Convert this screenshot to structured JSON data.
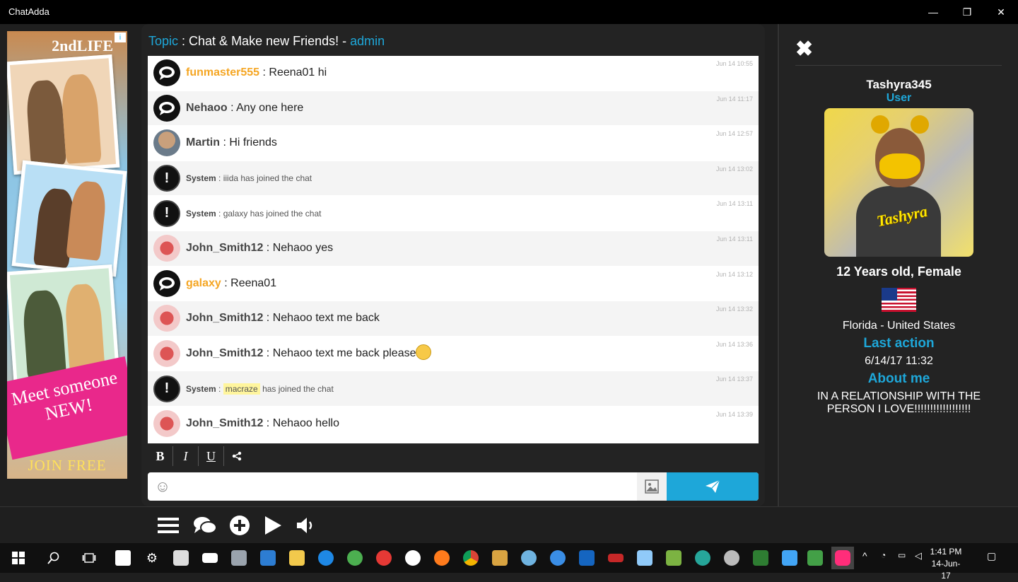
{
  "window": {
    "title": "ChatAdda",
    "minimize": "—",
    "maximize": "❐",
    "close": "✕"
  },
  "ad": {
    "brand": "2ndLIFE",
    "info": "i",
    "tagline": "Meet someone NEW!",
    "cta": "JOIN FREE"
  },
  "topic": {
    "label": "Topic",
    "text": " : Chat & Make new Friends! - ",
    "author": "admin"
  },
  "messages": [
    {
      "user": "funmaster555",
      "text": " : Reena01 hi",
      "time": "Jun 14 10:55",
      "avatar": "bubble",
      "name_color": "orange",
      "kind": "chat"
    },
    {
      "user": "Nehaoo",
      "text": " : Any one here",
      "time": "Jun 14 11:17",
      "avatar": "bubble",
      "name_color": "default",
      "kind": "chat"
    },
    {
      "user": "Martin",
      "text": " : Hi friends",
      "time": "Jun 14 12:57",
      "avatar": "photo",
      "name_color": "default",
      "kind": "chat"
    },
    {
      "user": "System",
      "text": " : iiida has joined the chat",
      "time": "Jun 14 13:02",
      "avatar": "alert",
      "name_color": "default",
      "kind": "system"
    },
    {
      "user": "System",
      "text": " : galaxy has joined the chat",
      "time": "Jun 14 13:11",
      "avatar": "alert",
      "name_color": "default",
      "kind": "system"
    },
    {
      "user": "John_Smith12",
      "text": " : Nehaoo yes",
      "time": "Jun 14 13:11",
      "avatar": "heart",
      "name_color": "default",
      "kind": "chat"
    },
    {
      "user": "galaxy",
      "text": " : Reena01",
      "time": "Jun 14 13:12",
      "avatar": "bubble",
      "name_color": "orange",
      "kind": "chat"
    },
    {
      "user": "John_Smith12",
      "text": " : Nehaoo text me back",
      "time": "Jun 14 13:32",
      "avatar": "heart",
      "name_color": "default",
      "kind": "chat"
    },
    {
      "user": "John_Smith12",
      "text": " : Nehaoo text me back please",
      "time": "Jun 14 13:36",
      "avatar": "heart",
      "name_color": "default",
      "kind": "chat",
      "emoji": "scared-face-emoji"
    },
    {
      "user": "System",
      "text": " : ",
      "highlight": "macraze",
      "text_after": " has joined the chat",
      "time": "Jun 14 13:37",
      "avatar": "alert",
      "name_color": "default",
      "kind": "system"
    },
    {
      "user": "John_Smith12",
      "text": " : Nehaoo hello",
      "time": "Jun 14 13:39",
      "avatar": "heart",
      "name_color": "default",
      "kind": "chat"
    }
  ],
  "format": {
    "bold": "B",
    "italic": "I",
    "underline": "U",
    "share": "⋖"
  },
  "input": {
    "placeholder": "",
    "value": "",
    "emoji_icon": "☺",
    "image_icon": "▨",
    "send_icon": "➤"
  },
  "profile": {
    "close": "✖",
    "username": "Tashyra345",
    "rank": "User",
    "photo_caption": "Tashyra",
    "age_gender": "12 Years old, Female",
    "location": "Florida - United States",
    "last_action_label": "Last action",
    "last_action": "6/14/17 11:32",
    "about_label": "About me",
    "about": "IN A RELATIONSHIP WITH THE PERSON I LOVE!!!!!!!!!!!!!!!!!!"
  },
  "bottom_bar": {
    "menu": "≡",
    "chat": "💬",
    "add": "⊕",
    "play": "▶",
    "sound": "🔈"
  },
  "taskbar": {
    "start": "⊞",
    "search": "⚲",
    "taskview": "❐",
    "settings": "⚙",
    "time": "1:41 PM",
    "date": "14-Jun-17",
    "tray_up": "^"
  },
  "colors": {
    "accent": "#1ea7d9",
    "orange": "#f5a623",
    "panel": "#232323"
  }
}
